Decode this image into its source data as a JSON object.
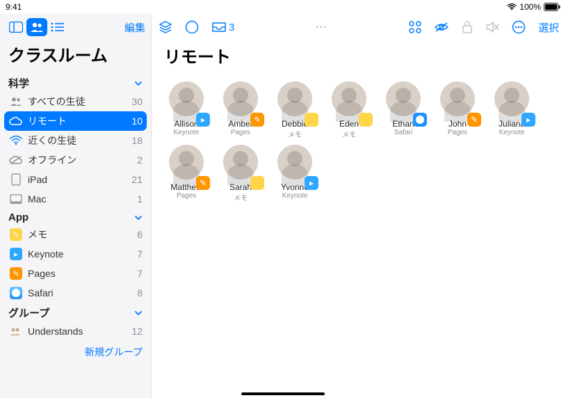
{
  "status": {
    "time": "9:41",
    "battery": "100%"
  },
  "sidebar": {
    "edit": "編集",
    "title": "クラスルーム",
    "sections": [
      {
        "header": "科学",
        "items": [
          {
            "icon": "people",
            "label": "すべての生徒",
            "count": "30"
          },
          {
            "icon": "cloud",
            "label": "リモート",
            "count": "10",
            "selected": true
          },
          {
            "icon": "wifi",
            "label": "近くの生徒",
            "count": "18"
          },
          {
            "icon": "cloud-off",
            "label": "オフライン",
            "count": "2"
          },
          {
            "icon": "ipad",
            "label": "iPad",
            "count": "21"
          },
          {
            "icon": "mac",
            "label": "Mac",
            "count": "1"
          }
        ]
      },
      {
        "header": "App",
        "items": [
          {
            "icon": "memo",
            "label": "メモ",
            "count": "6"
          },
          {
            "icon": "keynote",
            "label": "Keynote",
            "count": "7"
          },
          {
            "icon": "pages",
            "label": "Pages",
            "count": "7"
          },
          {
            "icon": "safari",
            "label": "Safari",
            "count": "8"
          }
        ]
      },
      {
        "header": "グループ",
        "items": [
          {
            "icon": "group",
            "label": "Understands",
            "count": "12"
          }
        ]
      }
    ],
    "new_group": "新規グループ"
  },
  "toolbar": {
    "inbox_count": "3",
    "select": "選択"
  },
  "content": {
    "title": "リモート",
    "students": [
      {
        "name": "Allison",
        "app": "Keynote",
        "badge": "keynote"
      },
      {
        "name": "Amber",
        "app": "Pages",
        "badge": "pages"
      },
      {
        "name": "Debbie",
        "app": "メモ",
        "badge": "memo"
      },
      {
        "name": "Eden",
        "app": "メモ",
        "badge": "memo"
      },
      {
        "name": "Ethan",
        "app": "Safari",
        "badge": "safari"
      },
      {
        "name": "John",
        "app": "Pages",
        "badge": "pages"
      },
      {
        "name": "Juliana",
        "app": "Keynote",
        "badge": "keynote"
      },
      {
        "name": "Matthew",
        "app": "Pages",
        "badge": "pages"
      },
      {
        "name": "Sarah",
        "app": "メモ",
        "badge": "memo"
      },
      {
        "name": "Yvonne",
        "app": "Keynote",
        "badge": "keynote"
      }
    ]
  }
}
